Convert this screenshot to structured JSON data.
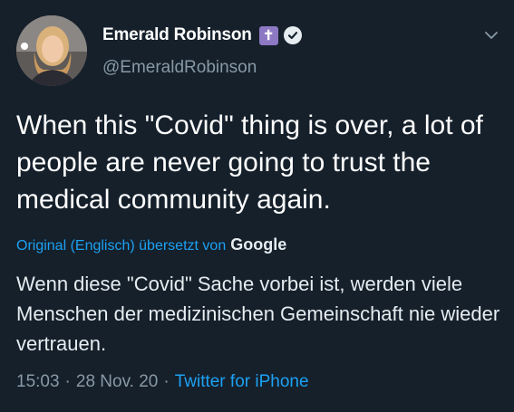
{
  "author": {
    "display_name": "Emerald Robinson",
    "handle": "@EmeraldRobinson",
    "cross_badge_glyph": "✝",
    "verified_icon": "verified-check-icon"
  },
  "tweet": {
    "text": "When this \"Covid\" thing is over, a lot of people are never going to trust the medical community again."
  },
  "translation": {
    "label": "Original (Englisch) übersetzt von",
    "provider": "Google",
    "text": "Wenn diese \"Covid\" Sache vorbei ist, werden viele Menschen der medizinischen Gemeinschaft nie wieder vertrauen."
  },
  "meta": {
    "time": "15:03",
    "separator": "·",
    "date": "28 Nov. 20",
    "source": "Twitter for iPhone"
  },
  "colors": {
    "background": "#15202b",
    "link": "#1da1f2",
    "secondary_text": "#8899a6",
    "badge": "#8d78c4"
  },
  "icons": {
    "menu": "chevron-down-icon"
  }
}
